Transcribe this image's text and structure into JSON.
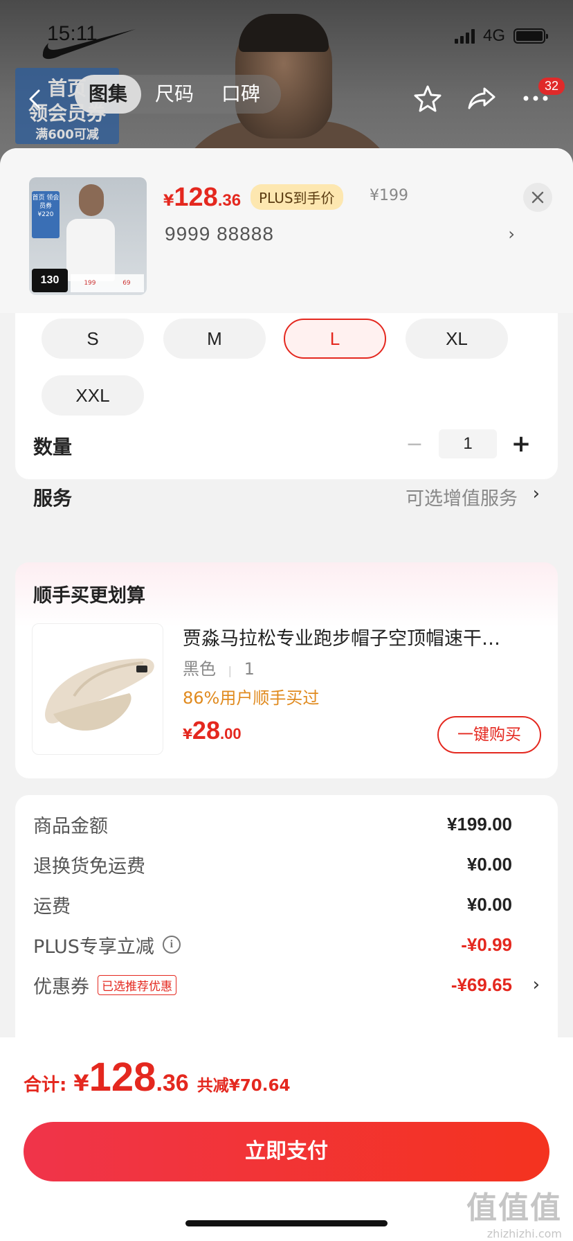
{
  "status_bar": {
    "time": "15:11",
    "network": "4G"
  },
  "background": {
    "promo_line1": "首页",
    "promo_line2": "领会员券",
    "promo_line3": "满600可减"
  },
  "nav": {
    "tabs": [
      {
        "label": "图集",
        "active": true
      },
      {
        "label": "尺码",
        "active": false
      },
      {
        "label": "口碑",
        "active": false
      }
    ],
    "badge_count": "32"
  },
  "product": {
    "price_symbol": "¥",
    "price_int": "128",
    "price_dec": ".36",
    "plus_tag": "PLUS到手价",
    "original_price": "¥199",
    "sku_text": "9999  88888",
    "sku_arrow": "›",
    "thumb_promo": "首页 领会员券 ¥220",
    "thumb_price": "130",
    "thumb_row": [
      "199",
      "69"
    ]
  },
  "sizes": [
    {
      "label": "S",
      "selected": false
    },
    {
      "label": "M",
      "selected": false
    },
    {
      "label": "L",
      "selected": true
    },
    {
      "label": "XL",
      "selected": false
    },
    {
      "label": "XXL",
      "selected": false
    }
  ],
  "quantity": {
    "label": "数量",
    "minus": "−",
    "value": "1",
    "plus": "+"
  },
  "service": {
    "label": "服务",
    "value": "可选增值服务",
    "arrow": "›"
  },
  "recommend": {
    "title": "顺手买更划算",
    "name": "贾淼马拉松专业跑步帽子空顶帽速干…",
    "color": "黑色",
    "qty": "1",
    "percent_text": "86%用户顺手买过",
    "price_symbol": "¥",
    "price_int": "28",
    "price_dec": ".00",
    "button": "一键购买"
  },
  "summary": [
    {
      "label": "商品金额",
      "value": "¥199.00",
      "red": false
    },
    {
      "label": "退换货免运费",
      "value": "¥0.00",
      "red": false
    },
    {
      "label": "运费",
      "value": "¥0.00",
      "red": false
    },
    {
      "label": "PLUS专享立减",
      "value": "-¥0.99",
      "red": true
    },
    {
      "label": "优惠券",
      "value": "-¥69.65",
      "red": true,
      "tag": "已选推荐优惠"
    }
  ],
  "summary_arrow": "›",
  "footer": {
    "total_label": "合计:",
    "price_symbol": "¥",
    "price_int": "128",
    "price_dec": ".36",
    "discount": "共减¥70.64",
    "pay_button": "立即支付"
  },
  "watermark": {
    "big": "值值值",
    "small": "zhizhizhi.com"
  },
  "colors": {
    "accent": "#e4281f",
    "plus_tag_bg": "#fde7b0",
    "coupon_orange": "#e08a1e"
  },
  "icons": [
    "back-icon",
    "star-icon",
    "share-icon",
    "more-icon",
    "close-icon",
    "info-icon",
    "nike-swoosh-logo"
  ]
}
